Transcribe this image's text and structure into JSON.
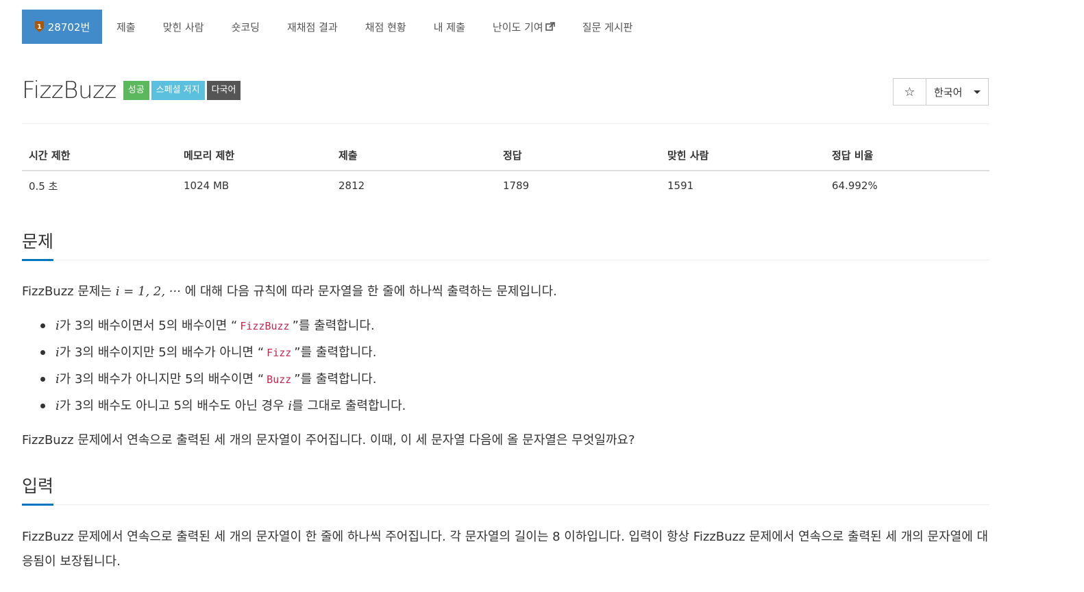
{
  "nav": {
    "problem_id": "28702번",
    "items": [
      "제출",
      "맞힌 사람",
      "숏코딩",
      "재채점 결과",
      "채점 현황",
      "내 제출",
      "난이도 기여",
      "질문 게시판"
    ],
    "medal_icon": "bronze-medal-icon",
    "external_icon": "external-link-icon"
  },
  "problem": {
    "title": "FizzBuzz",
    "badges": [
      "성공",
      "스페셜 저지",
      "다국어"
    ],
    "star_icon": "star-icon",
    "language": "한국어"
  },
  "stats": {
    "headers": [
      "시간 제한",
      "메모리 제한",
      "제출",
      "정답",
      "맞힌 사람",
      "정답 비율"
    ],
    "values": [
      "0.5 초",
      "1024 MB",
      "2812",
      "1789",
      "1591",
      "64.992%"
    ]
  },
  "sections": {
    "problem_heading": "문제",
    "input_heading": "입력"
  },
  "statement": {
    "intro_prefix": "FizzBuzz 문제는",
    "intro_math": "i = 1, 2, ···",
    "intro_suffix": "에 대해 다음 규칙에 따라 문자열을 한 줄에 하나씩 출력하는 문제입니다.",
    "rules": [
      {
        "before": "가 3의 배수이면서 5의 배수이면 “",
        "code": "FizzBuzz",
        "after": "”를 출력합니다."
      },
      {
        "before": "가 3의 배수이지만 5의 배수가 아니면 “",
        "code": "Fizz",
        "after": "”를 출력합니다."
      },
      {
        "before": "가 3의 배수가 아니지만 5의 배수이면 “",
        "code": "Buzz",
        "after": "”를 출력합니다."
      },
      {
        "before": "가 3의 배수도 아니고 5의 배수도 아닌 경우 ",
        "code": "",
        "after": "를 그대로 출력합니다."
      }
    ],
    "rule_var": "i",
    "question": "FizzBuzz 문제에서 연속으로 출력된 세 개의 문자열이 주어집니다. 이때, 이 세 문자열 다음에 올 문자열은 무엇일까요?"
  },
  "input": {
    "text": "FizzBuzz 문제에서 연속으로 출력된 세 개의 문자열이 한 줄에 하나씩 주어집니다. 각 문자열의 길이는 8 이하입니다. 입력이 항상 FizzBuzz 문제에서 연속으로 출력된 세 개의 문자열에 대응됨이 보장됩니다."
  }
}
